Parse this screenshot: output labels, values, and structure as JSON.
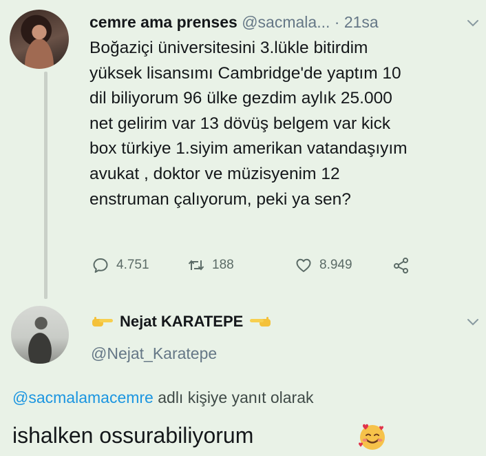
{
  "tweet": {
    "author_name": "cemre ama prenses",
    "author_handle": "@sacmala...",
    "separator": "·",
    "time": "21sa",
    "lines": [
      "Boğaziçi üniversitesini 3.lükle bitirdim",
      "yüksek lisansımı Cambridge'de yaptım 10",
      "dil biliyorum 96 ülke gezdim aylık 25.000",
      "net gelirim var 13 dövüş belgem var kick",
      "box türkiye 1.siyim amerikan vatandaşıyım",
      "avukat , doktor ve müzisyenim 12",
      "enstruman çalıyorum, peki ya sen?"
    ],
    "replies_count": "4.751",
    "retweets_count": "188",
    "likes_count": "8.949"
  },
  "reply": {
    "author_name": "Nejat KARATEPE",
    "author_handle": "@Nejat_Karatepe",
    "context_mention": "@sacmalamacemre",
    "context_suffix": " adlı kişiye yanıt olarak",
    "text": "ishalken ossurabiliyorum"
  },
  "icons": {
    "reply": "comment-bubble-icon",
    "retweet": "retweet-icon",
    "like": "heart-icon",
    "share": "share-icon",
    "menu": "chevron-down-icon",
    "name_left": "backhand-index-pointing-right-emoji",
    "name_right": "backhand-index-pointing-left-emoji",
    "reaction": "smiling-face-with-hearts-emoji"
  },
  "colors": {
    "background": "#e9f2e7",
    "text": "#14171a",
    "secondary": "#657786",
    "link": "#1b95e0"
  }
}
